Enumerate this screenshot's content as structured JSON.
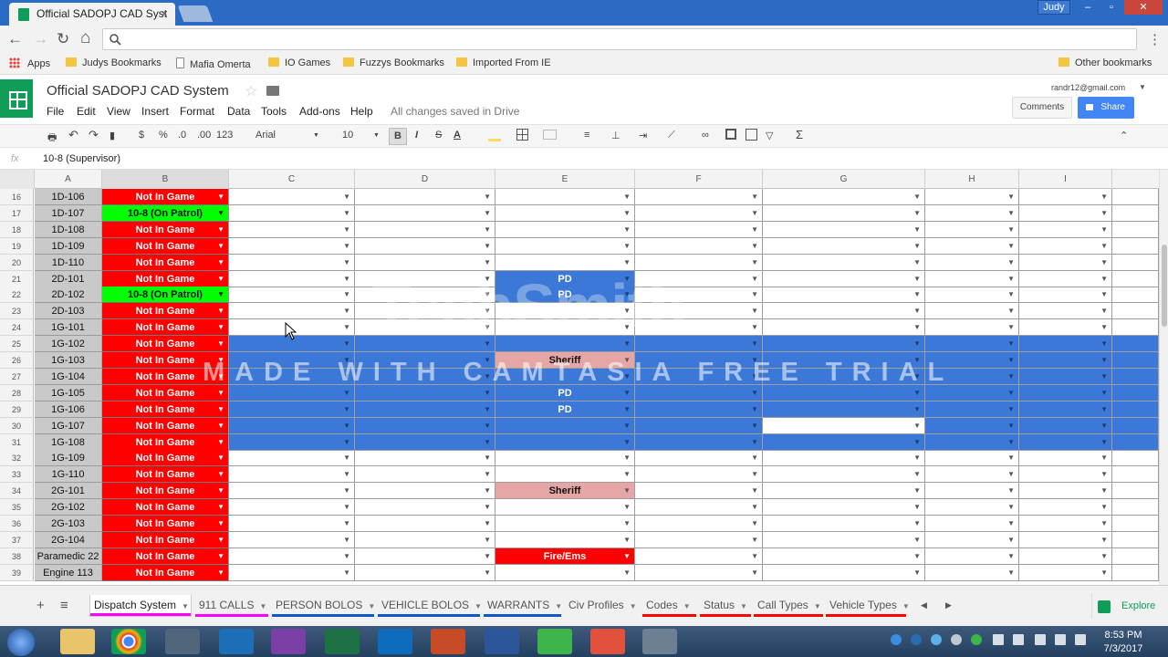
{
  "browser": {
    "tab_title": "Official SADOPJ CAD Syst",
    "tab_close": "×",
    "profile": "Judy",
    "window_buttons": [
      "–",
      "▫",
      "✕"
    ],
    "nav": {
      "back": "←",
      "forward": "→",
      "reload": "↻",
      "home": "⌂",
      "menu": "⋮"
    },
    "address_placeholder": ""
  },
  "bookmarks": {
    "apps": "Apps",
    "items": [
      "Judys Bookmarks",
      "Mafia Omerta",
      "IO Games",
      "Fuzzys Bookmarks",
      "Imported From IE"
    ],
    "other": "Other bookmarks"
  },
  "doc": {
    "title": "Official SADOPJ CAD System",
    "menus": [
      "File",
      "Edit",
      "View",
      "Insert",
      "Format",
      "Data",
      "Tools",
      "Add-ons",
      "Help"
    ],
    "save_status": "All changes saved in Drive",
    "account": "randr12@gmail.com",
    "comments": "Comments",
    "share": "Share"
  },
  "toolbar": {
    "currency": "$",
    "percent": "%",
    "dec_decrease": ".0",
    "dec_increase": ".00",
    "more_formats": "123",
    "font": "Arial",
    "size": "10",
    "bold": "B",
    "italic": "I",
    "strike": "S",
    "textcolor": "A",
    "sum": "Σ"
  },
  "formula_bar": {
    "fx": "fx",
    "value": "10-8 (Supervisor)"
  },
  "columns": [
    "A",
    "B",
    "C",
    "D",
    "E",
    "F",
    "G",
    "H",
    "I"
  ],
  "rows": [
    {
      "n": "16",
      "a": "1D-106",
      "b": "Not In Game",
      "status": "red",
      "fill": "",
      "e": "",
      "ecolor": ""
    },
    {
      "n": "17",
      "a": "1D-107",
      "b": "10-8 (On Patrol)",
      "status": "green",
      "fill": "",
      "e": "",
      "ecolor": ""
    },
    {
      "n": "18",
      "a": "1D-108",
      "b": "Not In Game",
      "status": "red",
      "fill": "",
      "e": "",
      "ecolor": ""
    },
    {
      "n": "19",
      "a": "1D-109",
      "b": "Not In Game",
      "status": "red",
      "fill": "",
      "e": "",
      "ecolor": ""
    },
    {
      "n": "20",
      "a": "1D-110",
      "b": "Not In Game",
      "status": "red",
      "fill": "",
      "e": "",
      "ecolor": ""
    },
    {
      "n": "21",
      "a": "2D-101",
      "b": "Not In Game",
      "status": "red",
      "fill": "",
      "e": "PD",
      "ecolor": "blue"
    },
    {
      "n": "22",
      "a": "2D-102",
      "b": "10-8 (On Patrol)",
      "status": "green",
      "fill": "",
      "e": "PD",
      "ecolor": "blue"
    },
    {
      "n": "23",
      "a": "2D-103",
      "b": "Not In Game",
      "status": "red",
      "fill": "",
      "e": "",
      "ecolor": ""
    },
    {
      "n": "24",
      "a": "1G-101",
      "b": "Not In Game",
      "status": "red",
      "fill": "",
      "e": "",
      "ecolor": ""
    },
    {
      "n": "25",
      "a": "1G-102",
      "b": "Not In Game",
      "status": "red",
      "fill": "blue",
      "e": "",
      "ecolor": "blue"
    },
    {
      "n": "26",
      "a": "1G-103",
      "b": "Not In Game",
      "status": "red",
      "fill": "blue",
      "e": "Sheriff",
      "ecolor": "pink"
    },
    {
      "n": "27",
      "a": "1G-104",
      "b": "Not In Game",
      "status": "red",
      "fill": "blue",
      "e": "",
      "ecolor": "blue"
    },
    {
      "n": "28",
      "a": "1G-105",
      "b": "Not In Game",
      "status": "red",
      "fill": "blue",
      "e": "PD",
      "ecolor": "blue"
    },
    {
      "n": "29",
      "a": "1G-106",
      "b": "Not In Game",
      "status": "red",
      "fill": "blue",
      "e": "PD",
      "ecolor": "blue"
    },
    {
      "n": "30",
      "a": "1G-107",
      "b": "Not In Game",
      "status": "red",
      "fill": "blue",
      "e": "",
      "ecolor": "blue"
    },
    {
      "n": "31",
      "a": "1G-108",
      "b": "Not In Game",
      "status": "red",
      "fill": "blue",
      "e": "",
      "ecolor": "blue"
    },
    {
      "n": "32",
      "a": "1G-109",
      "b": "Not In Game",
      "status": "red",
      "fill": "",
      "e": "",
      "ecolor": ""
    },
    {
      "n": "33",
      "a": "1G-110",
      "b": "Not In Game",
      "status": "red",
      "fill": "",
      "e": "",
      "ecolor": ""
    },
    {
      "n": "34",
      "a": "2G-101",
      "b": "Not In Game",
      "status": "red",
      "fill": "",
      "e": "Sheriff",
      "ecolor": "pink"
    },
    {
      "n": "35",
      "a": "2G-102",
      "b": "Not In Game",
      "status": "red",
      "fill": "",
      "e": "",
      "ecolor": ""
    },
    {
      "n": "36",
      "a": "2G-103",
      "b": "Not In Game",
      "status": "red",
      "fill": "",
      "e": "",
      "ecolor": ""
    },
    {
      "n": "37",
      "a": "2G-104",
      "b": "Not In Game",
      "status": "red",
      "fill": "",
      "e": "",
      "ecolor": ""
    },
    {
      "n": "38",
      "a": "Paramedic 22",
      "b": "Not In Game",
      "status": "red",
      "fill": "",
      "e": "Fire/Ems",
      "ecolor": "red"
    },
    {
      "n": "39",
      "a": "Engine 113",
      "b": "Not In Game",
      "status": "red",
      "fill": "",
      "e": "",
      "ecolor": ""
    }
  ],
  "colors": {
    "red": "#ff0000",
    "green": "#00ff00",
    "blue": "#3c78d8",
    "pink": "#e6a6a6",
    "sheets_green": "#0f9d58",
    "share_blue": "#4285f4"
  },
  "watermark": {
    "brand": "TechSmith",
    "trial": "MADE WITH CAMTASIA FREE TRIAL"
  },
  "sheet_tabs": [
    {
      "label": "Dispatch System",
      "color": "#ff00ff",
      "active": true
    },
    {
      "label": "911 CALLS",
      "color": "#ff00ff",
      "active": false
    },
    {
      "label": "PERSON BOLOS",
      "color": "#1155cc",
      "active": false
    },
    {
      "label": "VEHICLE BOLOS",
      "color": "#1155cc",
      "active": false
    },
    {
      "label": "WARRANTS",
      "color": "#1155cc",
      "active": false
    },
    {
      "label": "Civ Profiles",
      "color": "",
      "active": false
    },
    {
      "label": "Codes",
      "color": "#ff0000",
      "active": false
    },
    {
      "label": "Status",
      "color": "#ff0000",
      "active": false
    },
    {
      "label": "Call Types",
      "color": "#ff0000",
      "active": false
    },
    {
      "label": "Vehicle Types",
      "color": "#ff0000",
      "active": false
    }
  ],
  "sheet_controls": {
    "add": "+",
    "all": "≡",
    "prev": "◀",
    "next": "▶",
    "explore": "Explore"
  },
  "taskbar": {
    "time": "8:53 PM",
    "date": "7/3/2017"
  }
}
